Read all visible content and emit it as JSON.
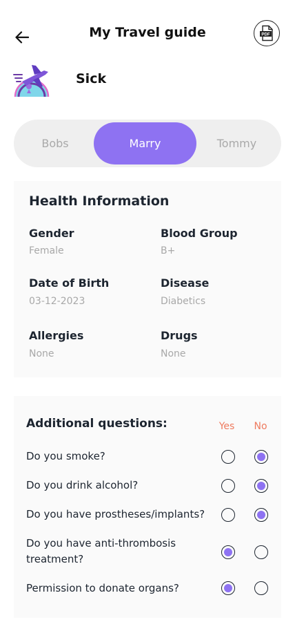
{
  "header": {
    "title": "My Travel guide",
    "pdf_label": "PDF"
  },
  "screen_label": "Sick",
  "segments": [
    {
      "label": "Bobs",
      "active": false
    },
    {
      "label": "Marry",
      "active": true
    },
    {
      "label": "Tommy",
      "active": false
    }
  ],
  "health": {
    "title": "Health Information",
    "fields": [
      {
        "label": "Gender",
        "value": "Female"
      },
      {
        "label": "Blood Group",
        "value": "B+"
      },
      {
        "label": "Date of Birth",
        "value": "03-12-2023"
      },
      {
        "label": "Disease",
        "value": "Diabetics"
      },
      {
        "label": "Allergies",
        "value": "None"
      },
      {
        "label": "Drugs",
        "value": "None"
      }
    ]
  },
  "questions": {
    "title": "Additional questions:",
    "yes_label": "Yes",
    "no_label": "No",
    "items": [
      {
        "text": "Do you smoke?",
        "answer": "no"
      },
      {
        "text": "Do you drink alcohol?",
        "answer": "no"
      },
      {
        "text": "Do you have prostheses/implants?",
        "answer": "no"
      },
      {
        "text": "Do you have anti-thrombosis treatment?",
        "answer": "yes"
      },
      {
        "text": "Permission to donate organs?",
        "answer": "yes"
      }
    ]
  },
  "colors": {
    "accent": "#8e72f2",
    "yes_no_heading": "#ee7a5e",
    "muted": "#a8a8a8"
  },
  "icons": {
    "back": "arrow-left-icon",
    "pdf": "pdf-file-icon",
    "logo": "airplane-globe-icon"
  }
}
